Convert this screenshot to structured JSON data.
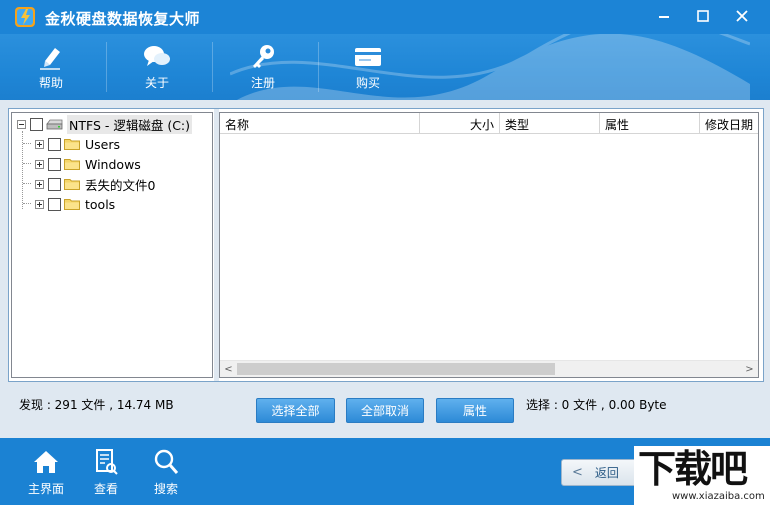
{
  "window": {
    "title": "金秋硬盘数据恢复大师"
  },
  "toolbar": {
    "items": [
      {
        "label": "帮助",
        "icon": "help-pen-icon"
      },
      {
        "label": "关于",
        "icon": "chat-bubbles-icon"
      },
      {
        "label": "注册",
        "icon": "key-icon"
      },
      {
        "label": "购买",
        "icon": "card-icon"
      }
    ]
  },
  "tree": {
    "root": {
      "label": "NTFS - 逻辑磁盘 (C:)",
      "icon": "drive-icon"
    },
    "children": [
      {
        "label": "Users",
        "icon": "folder-icon"
      },
      {
        "label": "Windows",
        "icon": "folder-icon"
      },
      {
        "label": "丢失的文件0",
        "icon": "folder-icon"
      },
      {
        "label": "tools",
        "icon": "folder-icon"
      }
    ]
  },
  "list": {
    "columns": [
      "名称",
      "大小",
      "类型",
      "属性",
      "修改日期"
    ]
  },
  "status": {
    "found": "发现 : 291 文件 , 14.74 MB",
    "selected": "选择 : 0 文件 , 0.00 Byte"
  },
  "actions": {
    "select_all": "选择全部",
    "deselect_all": "全部取消",
    "properties": "属性"
  },
  "bottom": {
    "items": [
      {
        "label": "主界面",
        "icon": "home-icon"
      },
      {
        "label": "查看",
        "icon": "view-doc-icon"
      },
      {
        "label": "搜索",
        "icon": "search-icon"
      }
    ],
    "back_label": "返回"
  },
  "watermark": {
    "main": "下载吧",
    "sub": "www.xiazaiba.com"
  },
  "colors": {
    "brand_blue": "#1c84d6",
    "button_blue": "#2d8ad7"
  }
}
